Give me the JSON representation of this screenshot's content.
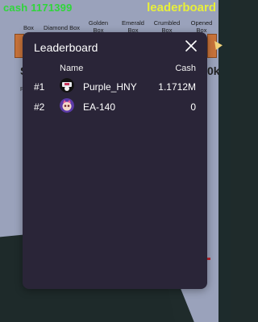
{
  "hud": {
    "cash": "cash 1171399",
    "leaderboard": "leaderboard"
  },
  "shop_boxes": [
    {
      "label": "Box"
    },
    {
      "label": "Diamond Box"
    },
    {
      "label": "Golden Box"
    },
    {
      "label": "Emerald Box"
    },
    {
      "label": "Crumbled Box"
    },
    {
      "label": "Opened Box"
    }
  ],
  "side_text": {
    "left_big": "S",
    "left_small": "R",
    "right_big": "0k"
  },
  "leaderboard": {
    "title": "Leaderboard",
    "columns": {
      "name": "Name",
      "cash": "Cash"
    },
    "rows": [
      {
        "rank": "#1",
        "name": "Purple_HNY",
        "cash": "1.1712M",
        "avatar": "penguin-avatar-icon"
      },
      {
        "rank": "#2",
        "name": "EA-140",
        "cash": "0",
        "avatar": "cat-avatar-icon"
      }
    ]
  },
  "colors": {
    "modal_bg": "#2a2538",
    "cash_green": "#2fd63a",
    "leaderboard_yellow": "#e8ef3a"
  }
}
